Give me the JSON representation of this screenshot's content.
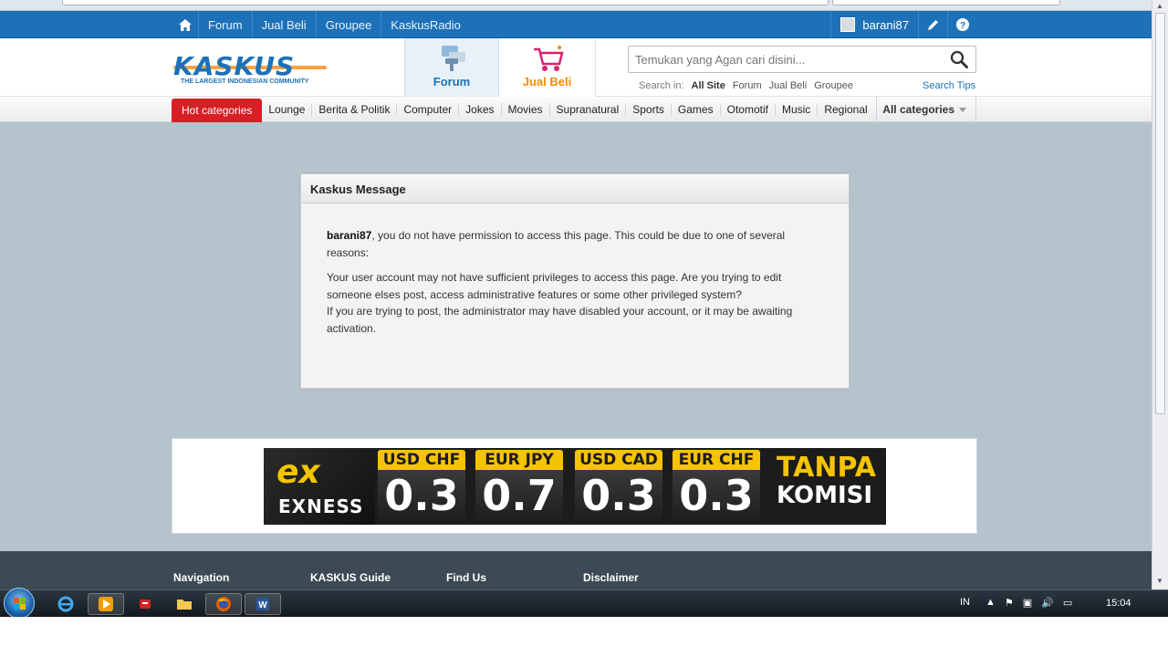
{
  "topbar": {
    "links": [
      "Forum",
      "Jual Beli",
      "Groupee",
      "KaskusRadio"
    ],
    "username": "barani87"
  },
  "header": {
    "logo_text": "KASKUS",
    "logo_tagline": "THE LARGEST INDONESIAN COMMUNITY",
    "tab_forum": "Forum",
    "tab_jualbeli": "Jual Beli",
    "search_placeholder": "Temukan yang Agan cari disini...",
    "search_in_label": "Search in:",
    "search_options": [
      "All Site",
      "Forum",
      "Jual Beli",
      "Groupee"
    ],
    "search_tips": "Search Tips"
  },
  "categories": {
    "hot": "Hot categories",
    "items": [
      "Lounge",
      "Berita & Politik",
      "Computer",
      "Jokes",
      "Movies",
      "Supranatural",
      "Sports",
      "Games",
      "Otomotif",
      "Music",
      "Regional"
    ],
    "all": "All categories"
  },
  "message": {
    "title": "Kaskus Message",
    "user": "barani87",
    "line1": ", you do not have permission to access this page. This could be due to one of several reasons:",
    "line2": "Your user account may not have sufficient privileges to access this page. Are you trying to edit someone elses post, access administrative features or some other privileged system?",
    "line3": "If you are trying to post, the administrator may have disabled your account, or it may be awaiting activation."
  },
  "ad": {
    "brand": "EXNESS",
    "quotes": [
      {
        "pair": "USD CHF",
        "value": "0.3"
      },
      {
        "pair": "EUR JPY",
        "value": "0.7"
      },
      {
        "pair": "USD CAD",
        "value": "0.3"
      },
      {
        "pair": "EUR CHF",
        "value": "0.3"
      }
    ],
    "slogan1": "TANPA",
    "slogan2": "KOMISI"
  },
  "footer": {
    "cols": [
      "Navigation",
      "KASKUS Guide",
      "Find Us",
      "Disclaimer"
    ]
  },
  "taskbar": {
    "lang": "IN",
    "clock": "15:04"
  },
  "colors": {
    "brand_blue": "#1d71b8",
    "hot_red": "#d71f26",
    "jualbeli_orange": "#f28c00",
    "exness_yellow": "#f5c400"
  }
}
